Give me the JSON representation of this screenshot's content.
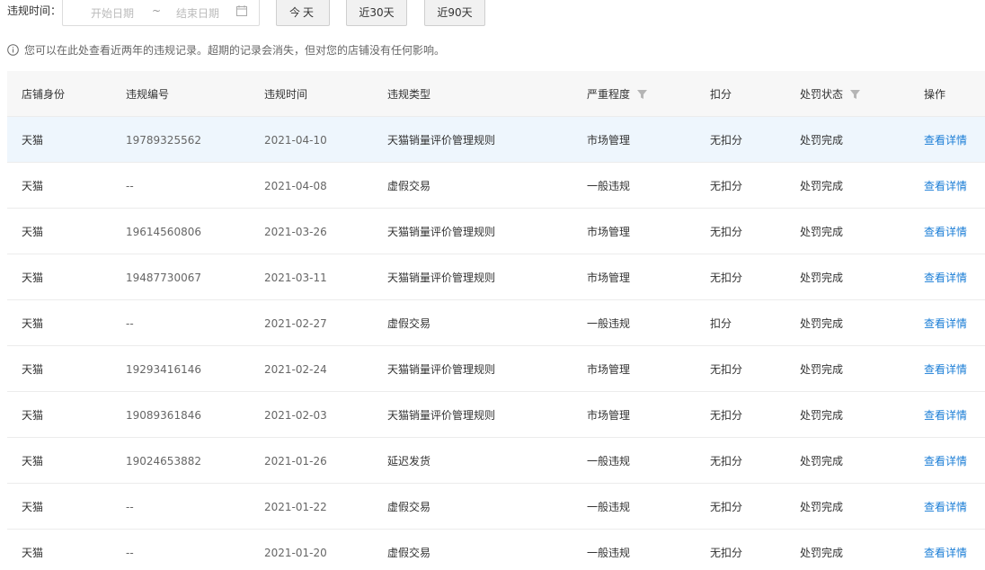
{
  "filter": {
    "label": "违规时间：",
    "start_placeholder": "开始日期",
    "separator": "~",
    "end_placeholder": "结束日期",
    "buttons": {
      "today": "今天",
      "last30": "近30天",
      "last90": "近90天"
    }
  },
  "notice": "您可以在此处查看近两年的违规记录。超期的记录会消失，但对您的店铺没有任何影响。",
  "table": {
    "headers": [
      "店铺身份",
      "违规编号",
      "违规时间",
      "违规类型",
      "严重程度",
      "扣分",
      "处罚状态",
      "操作"
    ],
    "rows": [
      {
        "shop": "天猫",
        "id": "19789325562",
        "date": "2021-04-10",
        "type": "天猫销量评价管理规则",
        "severity": "市场管理",
        "points": "无扣分",
        "status": "处罚完成",
        "action": "查看详情"
      },
      {
        "shop": "天猫",
        "id": "--",
        "date": "2021-04-08",
        "type": "虚假交易",
        "severity": "一般违规",
        "points": "无扣分",
        "status": "处罚完成",
        "action": "查看详情"
      },
      {
        "shop": "天猫",
        "id": "19614560806",
        "date": "2021-03-26",
        "type": "天猫销量评价管理规则",
        "severity": "市场管理",
        "points": "无扣分",
        "status": "处罚完成",
        "action": "查看详情"
      },
      {
        "shop": "天猫",
        "id": "19487730067",
        "date": "2021-03-11",
        "type": "天猫销量评价管理规则",
        "severity": "市场管理",
        "points": "无扣分",
        "status": "处罚完成",
        "action": "查看详情"
      },
      {
        "shop": "天猫",
        "id": "--",
        "date": "2021-02-27",
        "type": "虚假交易",
        "severity": "一般违规",
        "points": "扣分",
        "status": "处罚完成",
        "action": "查看详情"
      },
      {
        "shop": "天猫",
        "id": "19293416146",
        "date": "2021-02-24",
        "type": "天猫销量评价管理规则",
        "severity": "市场管理",
        "points": "无扣分",
        "status": "处罚完成",
        "action": "查看详情"
      },
      {
        "shop": "天猫",
        "id": "19089361846",
        "date": "2021-02-03",
        "type": "天猫销量评价管理规则",
        "severity": "市场管理",
        "points": "无扣分",
        "status": "处罚完成",
        "action": "查看详情"
      },
      {
        "shop": "天猫",
        "id": "19024653882",
        "date": "2021-01-26",
        "type": "延迟发货",
        "severity": "一般违规",
        "points": "无扣分",
        "status": "处罚完成",
        "action": "查看详情"
      },
      {
        "shop": "天猫",
        "id": "--",
        "date": "2021-01-22",
        "type": "虚假交易",
        "severity": "一般违规",
        "points": "无扣分",
        "status": "处罚完成",
        "action": "查看详情"
      },
      {
        "shop": "天猫",
        "id": "--",
        "date": "2021-01-20",
        "type": "虚假交易",
        "severity": "一般违规",
        "points": "无扣分",
        "status": "处罚完成",
        "action": "查看详情"
      }
    ]
  },
  "colors": {
    "link": "#1a7dd6",
    "highlight_row": "#eef6fd",
    "header_bg": "#f7f7f7"
  },
  "icons": {
    "calendar": "calendar-icon",
    "info": "info-icon",
    "filter": "filter-icon"
  }
}
